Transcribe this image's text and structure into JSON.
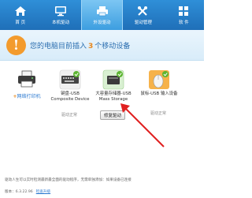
{
  "nav": {
    "items": [
      {
        "label": "首 页",
        "icon": "home-icon"
      },
      {
        "label": "本机驱动",
        "icon": "computer-icon"
      },
      {
        "label": "外设驱动",
        "icon": "printer-icon"
      },
      {
        "label": "驱动管理",
        "icon": "tools-icon"
      },
      {
        "label": "软 件",
        "icon": "apps-icon"
      }
    ],
    "active_index": 2
  },
  "banner": {
    "prefix": "您的电脑目前插入",
    "count": "3",
    "suffix": "个移动设备",
    "icon": "info-icon",
    "icon_char": "!"
  },
  "devices": [
    {
      "name": "网络打印机",
      "plus": "+",
      "status": ""
    },
    {
      "name_line1": "键盘-USB",
      "name_line2": "Composite Device",
      "status": "驱动正常"
    },
    {
      "name_line1": "大容量存储器-USB",
      "name_line2": "Mass Storage",
      "status": ""
    },
    {
      "name_line1": "鼠标-USB 输入设备",
      "name_line2": "",
      "status": "驱动正常"
    }
  ],
  "repair_button": {
    "label": "修复驱动"
  },
  "footer": {
    "notice": "驱动人生可以实时检测最新最全面的驱动程序，无需单独添加：如果设备已连接",
    "version_label": "版本：6.3.22.96",
    "update_label": "检查升级"
  },
  "colors": {
    "nav_bg": "#2f8fd8",
    "accent_orange": "#f39b2d",
    "check_green": "#5cb531",
    "arrow_red": "#e02020"
  }
}
